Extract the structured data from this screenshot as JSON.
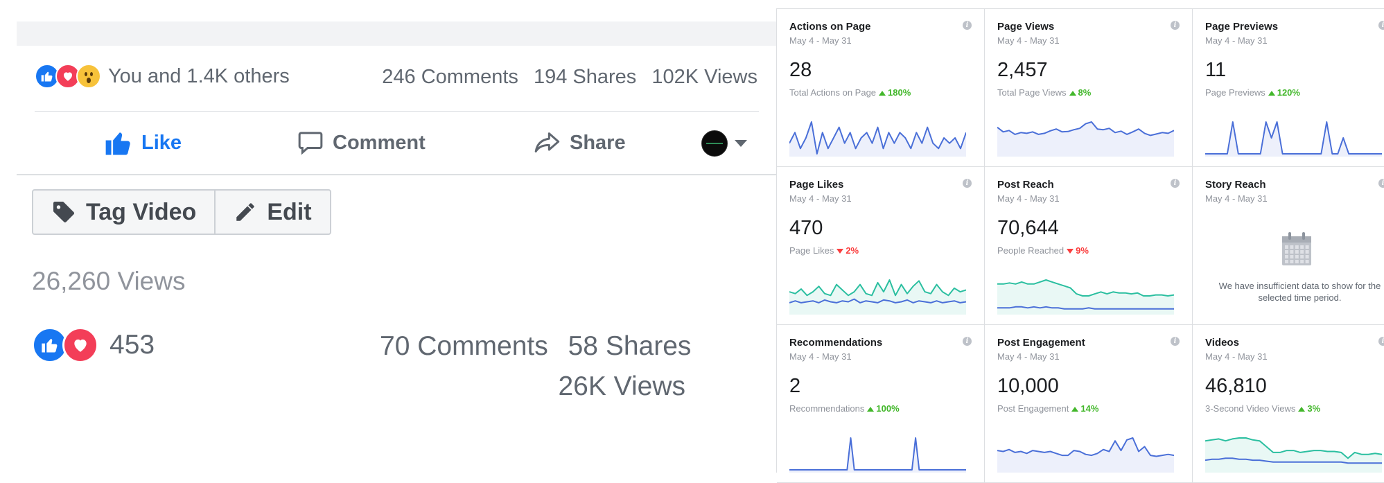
{
  "post": {
    "reaction_summary": "You and 1.4K others",
    "comments": "246 Comments",
    "shares": "194 Shares",
    "views": "102K Views",
    "actions": {
      "like": "Like",
      "comment": "Comment",
      "share": "Share"
    }
  },
  "video_toolbar": {
    "tag_label": "Tag Video",
    "edit_label": "Edit"
  },
  "video_stats": {
    "views": "26,260 Views",
    "reaction_count": "453",
    "comments": "70 Comments",
    "shares": "58 Shares",
    "views_short": "26K Views"
  },
  "colors": {
    "facebook_blue": "#1877f2",
    "love_red": "#f33e58",
    "up_green": "#42b72a",
    "down_red": "#fa3e3e",
    "spark_blue": "#4a6fd8",
    "spark_teal": "#2bbfa0"
  },
  "insights": {
    "cards": [
      {
        "title": "Actions on Page",
        "date": "May 4 - May 31",
        "value": "28",
        "sub_label": "Total Actions on Page",
        "change": "180%",
        "direction": "up",
        "series": [
          [
            2,
            4,
            1,
            3,
            6,
            0,
            4,
            1,
            3,
            5,
            2,
            4,
            1,
            3,
            4,
            2,
            5,
            1,
            4,
            2,
            4,
            3,
            1,
            4,
            2,
            5,
            2,
            1,
            3,
            2,
            3,
            1,
            4
          ]
        ]
      },
      {
        "title": "Page Views",
        "date": "May 4 - May 31",
        "value": "2,457",
        "sub_label": "Total Page Views",
        "change": "8%",
        "direction": "up",
        "series": [
          [
            75,
            62,
            66,
            55,
            60,
            58,
            62,
            55,
            58,
            65,
            70,
            62,
            63,
            68,
            72,
            85,
            90,
            70,
            68,
            72,
            60,
            64,
            55,
            62,
            70,
            58,
            52,
            56,
            60,
            58,
            66
          ]
        ]
      },
      {
        "title": "Page Previews",
        "date": "May 4 - May 31",
        "value": "11",
        "sub_label": "Page Previews",
        "change": "120%",
        "direction": "up",
        "series": [
          [
            0,
            0,
            0,
            0,
            0,
            2,
            0,
            0,
            0,
            0,
            0,
            2,
            1,
            2,
            0,
            0,
            0,
            0,
            0,
            0,
            0,
            0,
            2,
            0,
            0,
            1,
            0,
            0,
            0,
            0,
            0,
            0,
            0
          ]
        ]
      },
      {
        "title": "Page Likes",
        "date": "May 4 - May 31",
        "value": "470",
        "sub_label": "Page Likes",
        "change": "2%",
        "direction": "down",
        "series": [
          [
            22,
            20,
            25,
            18,
            22,
            28,
            20,
            18,
            30,
            24,
            18,
            22,
            30,
            20,
            18,
            32,
            22,
            35,
            18,
            30,
            20,
            28,
            34,
            22,
            20,
            30,
            22,
            18,
            26,
            22,
            24
          ],
          [
            10,
            12,
            10,
            11,
            12,
            10,
            13,
            11,
            10,
            12,
            11,
            14,
            10,
            12,
            11,
            10,
            13,
            12,
            10,
            11,
            13,
            10,
            12,
            11,
            10,
            12,
            10,
            11,
            12,
            10,
            11
          ]
        ]
      },
      {
        "title": "Post Reach",
        "date": "May 4 - May 31",
        "value": "70,644",
        "sub_label": "People Reached",
        "change": "9%",
        "direction": "down",
        "series": [
          [
            28,
            28,
            29,
            28,
            30,
            28,
            28,
            30,
            32,
            30,
            28,
            26,
            24,
            18,
            16,
            16,
            18,
            20,
            18,
            20,
            19,
            19,
            18,
            19,
            16,
            16,
            17,
            17,
            16,
            17
          ],
          [
            4,
            4,
            4,
            5,
            5,
            4,
            5,
            4,
            5,
            4,
            4,
            3,
            3,
            3,
            3,
            4,
            3,
            3,
            3,
            3,
            3,
            3,
            3,
            3,
            3,
            3,
            3,
            3,
            3,
            3
          ]
        ]
      },
      {
        "title": "Story Reach",
        "date": "May 4 - May 31",
        "value": "",
        "sub_label": "",
        "change": "",
        "direction": "none",
        "empty_message": "We have insufficient data to show for the selected time period.",
        "series": []
      },
      {
        "title": "Recommendations",
        "date": "May 4 - May 31",
        "value": "2",
        "sub_label": "Recommendations",
        "change": "100%",
        "direction": "up",
        "series": [
          [
            0,
            0,
            0,
            0,
            0,
            0,
            0,
            0,
            0,
            0,
            0,
            0,
            0,
            0,
            0,
            0,
            0,
            1,
            0,
            0,
            0,
            0,
            0,
            0,
            0,
            0,
            0,
            0,
            0,
            0,
            0,
            0,
            0,
            0,
            0,
            1,
            0,
            0,
            0,
            0,
            0,
            0,
            0,
            0,
            0,
            0,
            0,
            0,
            0,
            0
          ]
        ]
      },
      {
        "title": "Post Engagement",
        "date": "May 4 - May 31",
        "value": "10,000",
        "sub_label": "Post Engagement",
        "change": "14%",
        "direction": "up",
        "series": [
          [
            40,
            38,
            42,
            36,
            38,
            34,
            40,
            38,
            36,
            38,
            34,
            30,
            30,
            40,
            38,
            32,
            30,
            34,
            42,
            38,
            60,
            40,
            62,
            66,
            38,
            48,
            30,
            28,
            30,
            32,
            30
          ]
        ]
      },
      {
        "title": "Videos",
        "date": "May 4 - May 31",
        "value": "46,810",
        "sub_label": "3-Second Video Views",
        "change": "3%",
        "direction": "up",
        "series": [
          [
            30,
            31,
            32,
            30,
            32,
            33,
            33,
            31,
            30,
            24,
            18,
            18,
            20,
            20,
            18,
            19,
            20,
            20,
            19,
            19,
            18,
            12,
            18,
            16,
            16,
            17,
            16
          ],
          [
            10,
            11,
            11,
            12,
            12,
            11,
            11,
            10,
            10,
            9,
            8,
            8,
            8,
            8,
            8,
            8,
            8,
            8,
            8,
            8,
            8,
            7,
            7,
            7,
            7,
            7,
            7
          ]
        ]
      }
    ]
  }
}
